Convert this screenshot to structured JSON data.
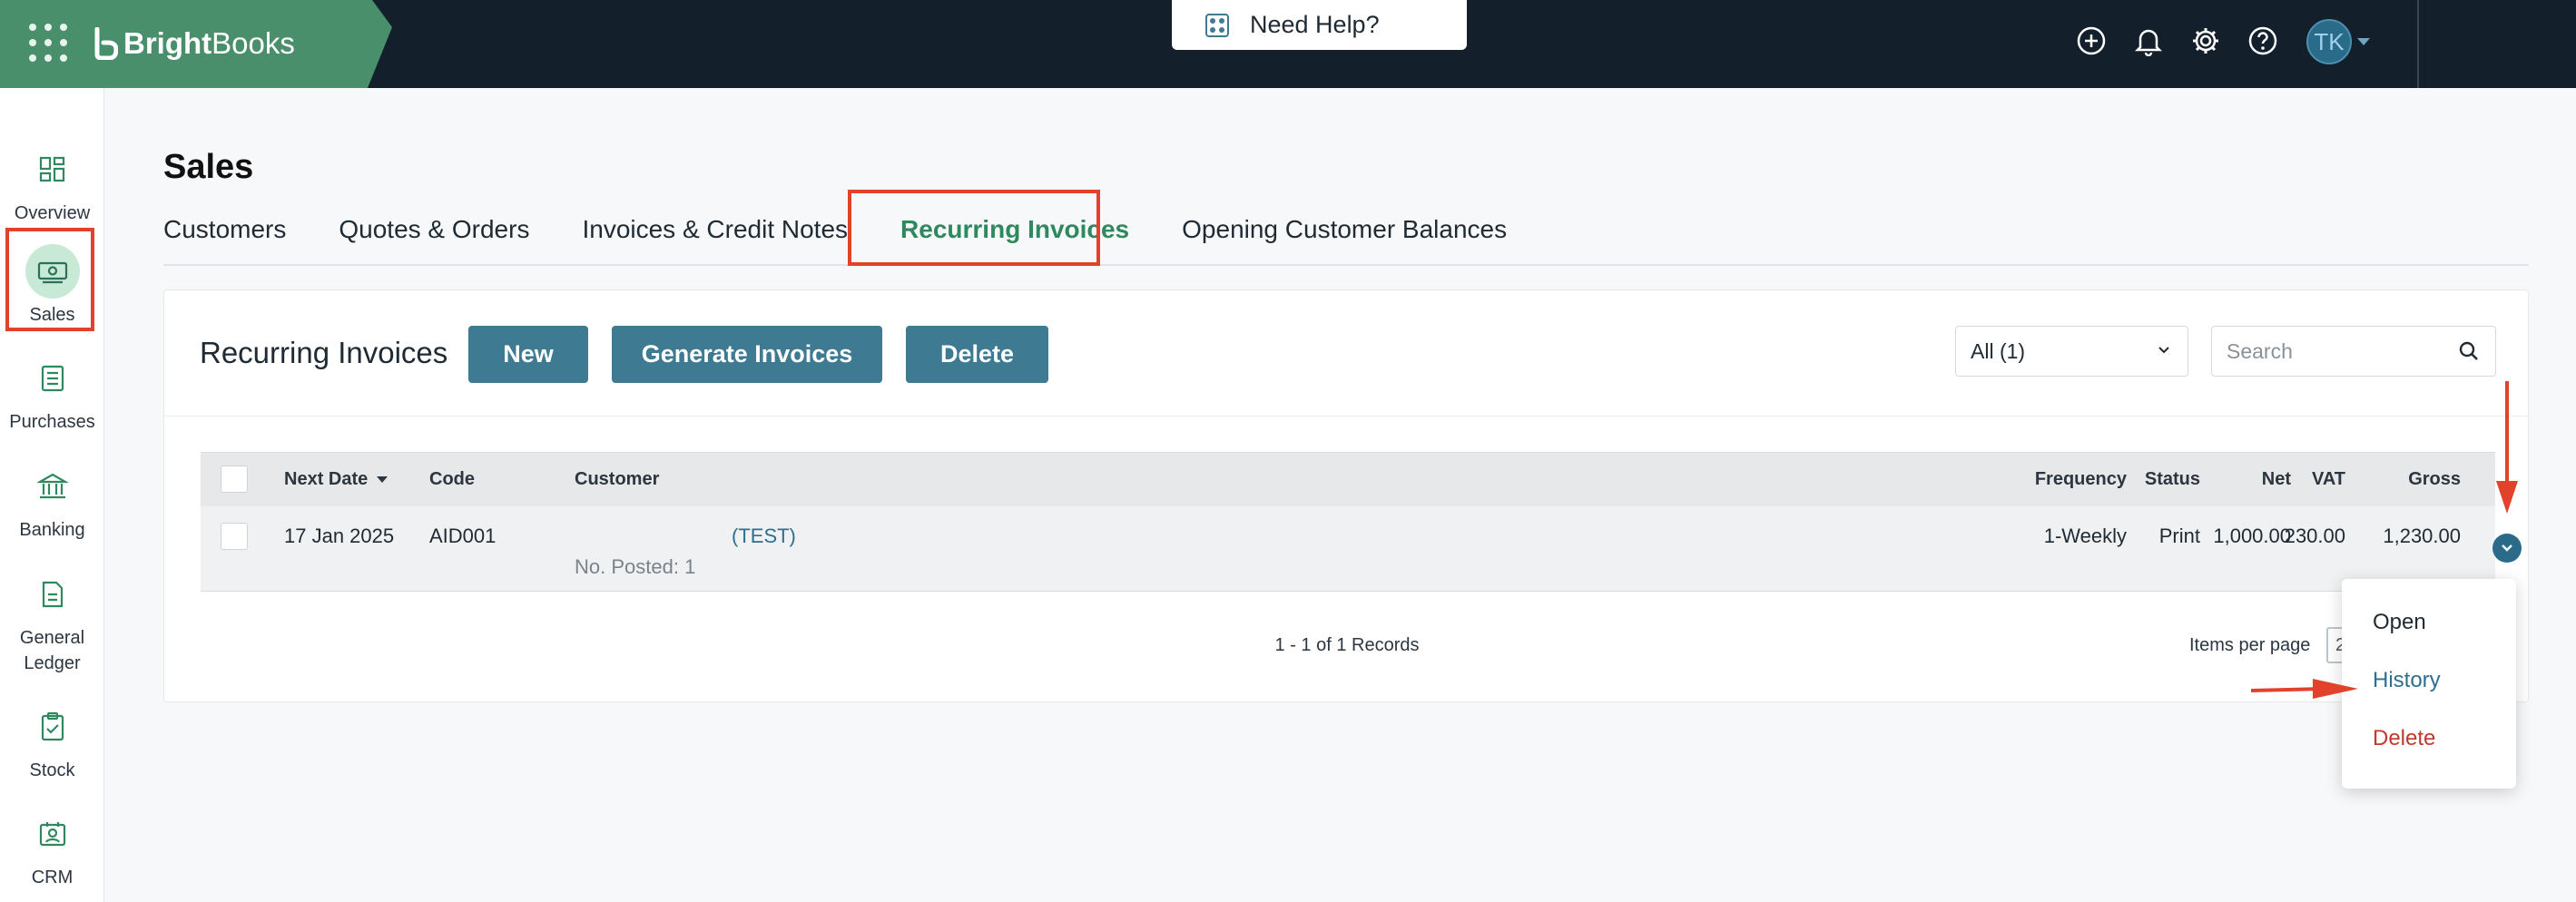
{
  "topbar": {
    "brand_bold": "Bright",
    "brand_light": "Books",
    "help_label": "Need Help?",
    "icons": [
      "add-icon",
      "bell-icon",
      "gear-icon",
      "help-icon"
    ],
    "avatar_initials": "TK"
  },
  "sidebar": {
    "items": [
      {
        "label": "Overview",
        "icon": "dashboard-icon"
      },
      {
        "label": "Sales",
        "icon": "money-icon"
      },
      {
        "label": "Purchases",
        "icon": "receipt-icon"
      },
      {
        "label": "Banking",
        "icon": "bank-icon"
      },
      {
        "label": "General Ledger",
        "icon": "document-icon"
      },
      {
        "label": "Stock",
        "icon": "clipboard-check-icon"
      },
      {
        "label": "CRM",
        "icon": "contact-card-icon"
      }
    ]
  },
  "page": {
    "title": "Sales",
    "tabs": [
      {
        "label": "Customers"
      },
      {
        "label": "Quotes & Orders"
      },
      {
        "label": "Invoices & Credit Notes"
      },
      {
        "label": "Recurring Invoices"
      },
      {
        "label": "Opening Customer Balances"
      }
    ]
  },
  "card": {
    "title": "Recurring Invoices",
    "new_label": "New",
    "generate_label": "Generate Invoices",
    "delete_label": "Delete",
    "filter_value": "All (1)",
    "search_placeholder": "Search"
  },
  "table": {
    "headers": {
      "next_date": "Next Date",
      "code": "Code",
      "customer": "Customer",
      "frequency": "Frequency",
      "status": "Status",
      "net": "Net",
      "vat": "VAT",
      "gross": "Gross"
    },
    "rows": [
      {
        "next_date": "17 Jan 2025",
        "code": "AID001",
        "customer": "(TEST)",
        "posted": "No. Posted: 1",
        "frequency": "1-Weekly",
        "status": "Print",
        "net": "1,000.00",
        "vat": "230.00",
        "gross": "1,230.00"
      }
    ],
    "records": "1 - 1 of 1 Records",
    "items_per_page_label": "Items per page",
    "items_per_page_value": "2"
  },
  "row_menu": {
    "open": "Open",
    "history": "History",
    "delete": "Delete"
  },
  "colors": {
    "brand_green": "#4a8f6b",
    "topbar": "#13202c",
    "button": "#3e7a91",
    "active_tab": "#2e8a5e",
    "annotation": "#e2412c"
  }
}
